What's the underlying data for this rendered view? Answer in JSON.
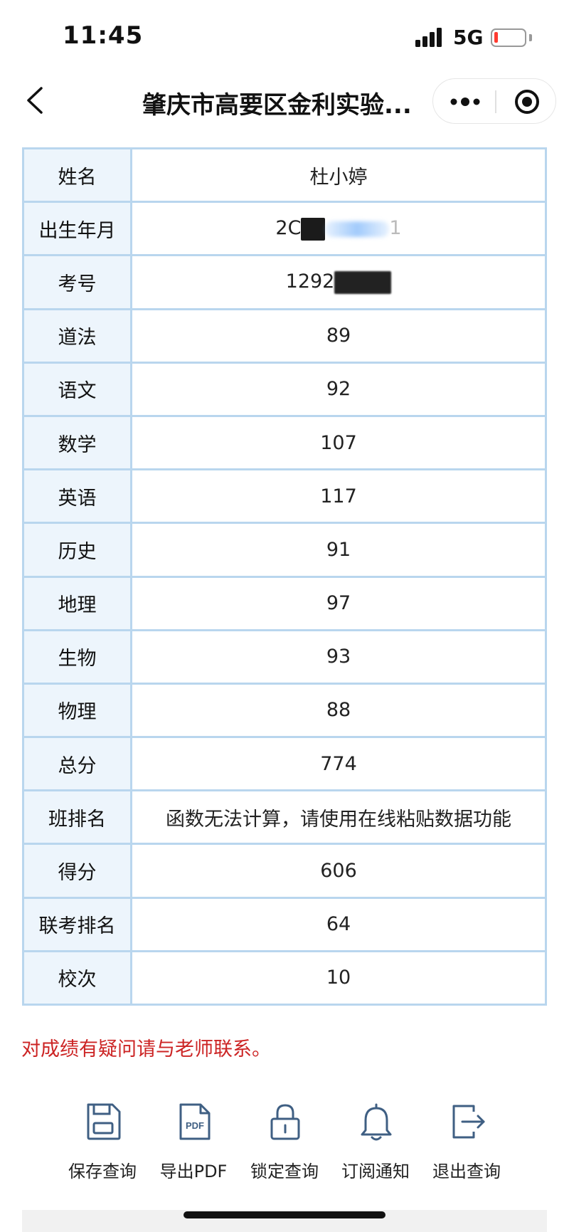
{
  "status_bar": {
    "time": "11:45",
    "network": "5G",
    "battery_level": 0.12,
    "battery_color": "#ff3b30",
    "icons": [
      "signal-icon",
      "battery-icon"
    ]
  },
  "nav": {
    "title": "肇庆市高要区金利实验...",
    "icons": [
      "back-icon",
      "more-icon",
      "close-miniprogram-icon"
    ]
  },
  "grades": {
    "name": {
      "label": "姓名",
      "value": "杜小婷"
    },
    "birth": {
      "label": "出生年月",
      "value_prefix": "2C",
      "value_suffix": "1"
    },
    "exam_no": {
      "label": "考号",
      "value_prefix": "1292"
    },
    "rows": [
      {
        "label": "道法",
        "value": "89"
      },
      {
        "label": "语文",
        "value": "92"
      },
      {
        "label": "数学",
        "value": "107"
      },
      {
        "label": "英语",
        "value": "117"
      },
      {
        "label": "历史",
        "value": "91"
      },
      {
        "label": "地理",
        "value": "97"
      },
      {
        "label": "生物",
        "value": "93"
      },
      {
        "label": "物理",
        "value": "88"
      },
      {
        "label": "总分",
        "value": "774"
      },
      {
        "label": "班排名",
        "value": "函数无法计算，请使用在线粘贴数据功能"
      },
      {
        "label": "得分",
        "value": "606"
      },
      {
        "label": "联考排名",
        "value": "64"
      },
      {
        "label": "校次",
        "value": "10"
      }
    ]
  },
  "notice": "对成绩有疑问请与老师联系。",
  "actions": [
    {
      "label": "保存查询",
      "icon": "save-icon"
    },
    {
      "label": "导出PDF",
      "icon": "pdf-icon"
    },
    {
      "label": "锁定查询",
      "icon": "lock-icon"
    },
    {
      "label": "订阅通知",
      "icon": "bell-icon"
    },
    {
      "label": "退出查询",
      "icon": "exit-icon"
    }
  ],
  "colors": {
    "accent": "#3f5f83",
    "notice": "#cc2424",
    "table_border": "#b9d6ee",
    "label_bg": "#edf5fc"
  }
}
